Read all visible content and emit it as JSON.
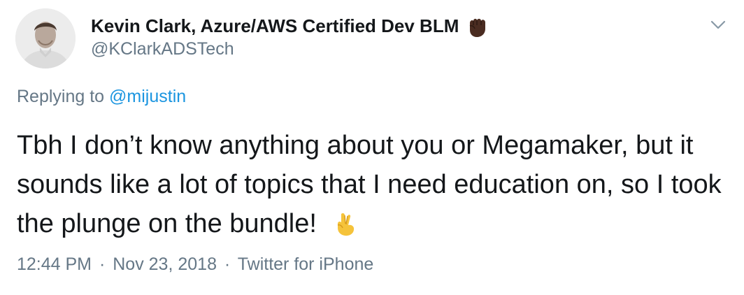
{
  "author": {
    "name": "Kevin Clark, Azure/AWS Certified Dev BLM",
    "handle": "@KClarkADSTech",
    "name_emoji_icon": "raised-fist-icon",
    "avatar_icon": "avatar-photo-icon"
  },
  "menu": {
    "icon": "chevron-down-icon"
  },
  "reply": {
    "prefix": "Replying to",
    "mention": "@mijustin"
  },
  "tweet": {
    "text": "Tbh I don’t know anything about you or Megamaker, but it sounds like a lot of topics that I need education on, so I took the plunge on the bundle!",
    "emoji_icon": "crossed-fingers-icon"
  },
  "meta": {
    "time": "12:44 PM",
    "separator": "·",
    "date": "Nov 23, 2018",
    "source": "Twitter for iPhone"
  },
  "colors": {
    "text": "#14171a",
    "secondary": "#657786",
    "link": "#1b95e0"
  }
}
